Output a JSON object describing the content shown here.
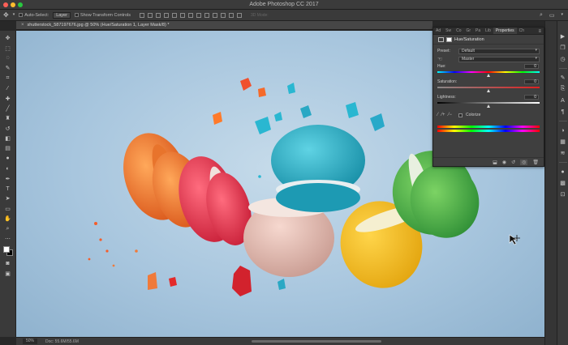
{
  "window": {
    "title": "Adobe Photoshop CC 2017",
    "traffic_colors": [
      "#fc5f57",
      "#fdbc2e",
      "#29c840"
    ]
  },
  "options_bar": {
    "auto_select_label": "Auto-Select:",
    "auto_select_value": "Layer",
    "transform_label": "Show Transform Controls",
    "mode_3d_label": "3D Mode:"
  },
  "document": {
    "tab_title": "shutterstock_587197676.jpg @ 50% (Hue/Saturation 1, Layer Mask/8) *"
  },
  "properties": {
    "tabs": [
      "Ad",
      "Sw",
      "Co",
      "Gr",
      "Pa",
      "Lib",
      "Properties",
      "Ch"
    ],
    "active_tab": "Properties",
    "header": "Hue/Saturation",
    "preset_label": "Preset:",
    "preset_value": "Default",
    "channel_value": "Master",
    "hue": {
      "label": "Hue:",
      "value": "0",
      "fraction": 0.5
    },
    "saturation": {
      "label": "Saturation:",
      "value": "0",
      "fraction": 0.5
    },
    "lightness": {
      "label": "Lightness:",
      "value": "0",
      "fraction": 0.5
    },
    "colorize_label": "Colorize"
  },
  "status": {
    "zoom": "50%",
    "doc": "Doc: 55.6M/55.6M"
  },
  "colors": {
    "background": "#a8c6de",
    "panel": "#3f3f3f"
  }
}
